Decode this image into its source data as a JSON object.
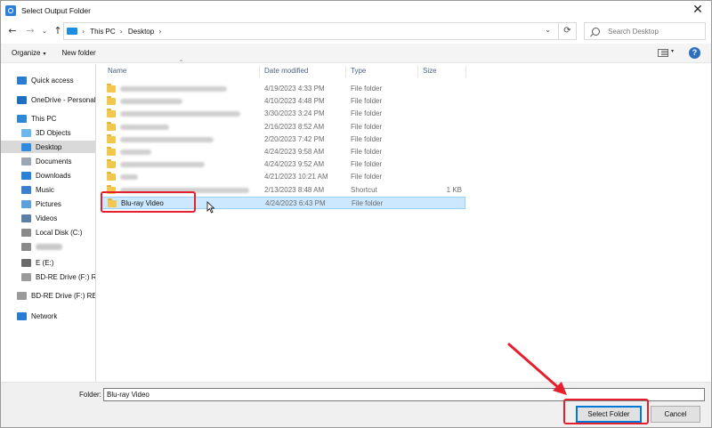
{
  "window": {
    "title": "Select Output Folder",
    "close_glyph": "✕"
  },
  "nav": {
    "back_glyph": "←",
    "forward_glyph": "→",
    "recent_glyph": "⌄",
    "up_glyph": "↑",
    "breadcrumbs": [
      "This PC",
      "Desktop"
    ],
    "breadcrumb_sep": "›",
    "address_dropdown_glyph": "⌄",
    "refresh_glyph": "⟳",
    "search_placeholder": "Search Desktop"
  },
  "toolbar": {
    "organize_label": "Organize",
    "organize_caret": "▾",
    "new_folder_label": "New folder",
    "view_caret": "▾",
    "help_glyph": "?"
  },
  "sidebar": {
    "items": [
      {
        "label": "Quick access",
        "icon": "star-icon",
        "color": "#2a7bd4"
      },
      {
        "label": "OneDrive - Personal",
        "icon": "cloud-icon",
        "color": "#1e6fc4"
      },
      {
        "label": "This PC",
        "icon": "computer-icon",
        "color": "#2b89d8"
      },
      {
        "label": "3D Objects",
        "icon": "cube-icon",
        "color": "#6cb7ec"
      },
      {
        "label": "Desktop",
        "icon": "desktop-icon",
        "color": "#2f8be0",
        "selected": true
      },
      {
        "label": "Documents",
        "icon": "documents-icon",
        "color": "#9aa6b2"
      },
      {
        "label": "Downloads",
        "icon": "downloads-icon",
        "color": "#2a82d6"
      },
      {
        "label": "Music",
        "icon": "music-icon",
        "color": "#3b7fcf"
      },
      {
        "label": "Pictures",
        "icon": "pictures-icon",
        "color": "#5aa0dc"
      },
      {
        "label": "Videos",
        "icon": "videos-icon",
        "color": "#5a7fa8"
      },
      {
        "label": "Local Disk (C:)",
        "icon": "disk-icon",
        "color": "#8a8a8a"
      },
      {
        "label": "",
        "icon": "drive-icon",
        "color": "#8a8a8a",
        "blurred": true
      },
      {
        "label": "E (E:)",
        "icon": "drive-icon",
        "color": "#6a6a6a"
      },
      {
        "label": "BD-RE Drive (F:) RESI",
        "icon": "disc-icon",
        "color": "#9a9a9a"
      },
      {
        "label": "BD-RE Drive (F:) RESI",
        "icon": "disc-icon",
        "color": "#9a9a9a"
      },
      {
        "label": "Network",
        "icon": "network-icon",
        "color": "#2a7bd4"
      }
    ]
  },
  "columns": {
    "name": "Name",
    "date": "Date modified",
    "type": "Type",
    "size": "Size",
    "sort_glyph": "^"
  },
  "files": [
    {
      "name": "",
      "date": "4/19/2023 4:33 PM",
      "type": "File folder",
      "size": "",
      "blurred": true
    },
    {
      "name": "",
      "date": "4/10/2023 4:48 PM",
      "type": "File folder",
      "size": "",
      "blurred": true
    },
    {
      "name": "",
      "date": "3/30/2023 3:24 PM",
      "type": "File folder",
      "size": "",
      "blurred": true
    },
    {
      "name": "",
      "date": "2/16/2023 8:52 AM",
      "type": "File folder",
      "size": "",
      "blurred": true
    },
    {
      "name": "",
      "date": "2/20/2023 7:42 PM",
      "type": "File folder",
      "size": "",
      "blurred": true
    },
    {
      "name": "",
      "date": "4/24/2023 9:58 AM",
      "type": "File folder",
      "size": "",
      "blurred": true
    },
    {
      "name": "",
      "date": "4/24/2023 9:52 AM",
      "type": "File folder",
      "size": "",
      "blurred": true
    },
    {
      "name": "",
      "date": "4/21/2023 10:21 AM",
      "type": "File folder",
      "size": "",
      "blurred": true
    },
    {
      "name": "",
      "date": "2/13/2023 8:48 AM",
      "type": "Shortcut",
      "size": "1 KB",
      "blurred": true
    },
    {
      "name": "Blu-ray Video",
      "date": "4/24/2023 6:43 PM",
      "type": "File folder",
      "size": "",
      "selected": true
    }
  ],
  "footer": {
    "folder_label": "Folder:",
    "folder_value": "Blu-ray Video",
    "select_label": "Select Folder",
    "cancel_label": "Cancel"
  },
  "annotation_color": "#e4202e"
}
